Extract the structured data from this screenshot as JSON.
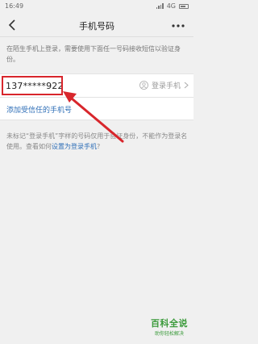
{
  "status_bar": {
    "time": "16:49",
    "network": "4G"
  },
  "nav": {
    "title": "手机号码",
    "more_label": "···"
  },
  "notice": {
    "text": "在陌生手机上登录，需要使用下面任一号码接收短信以验证身份。"
  },
  "phone_row": {
    "number": "137*****922",
    "login_label": "登录手机"
  },
  "add_row": {
    "label": "添加受信任的手机号"
  },
  "footnote": {
    "text": "未标记“登录手机”字样的号码仅用于验证身份，不能作为登录名使用。查看如何",
    "link_text": "设置为登录手机",
    "suffix": "?"
  },
  "watermark": {
    "title": "百科全说",
    "subtitle": "助你轻松解决"
  },
  "colors": {
    "highlight": "#d8262c",
    "link": "#2f6fb7"
  }
}
